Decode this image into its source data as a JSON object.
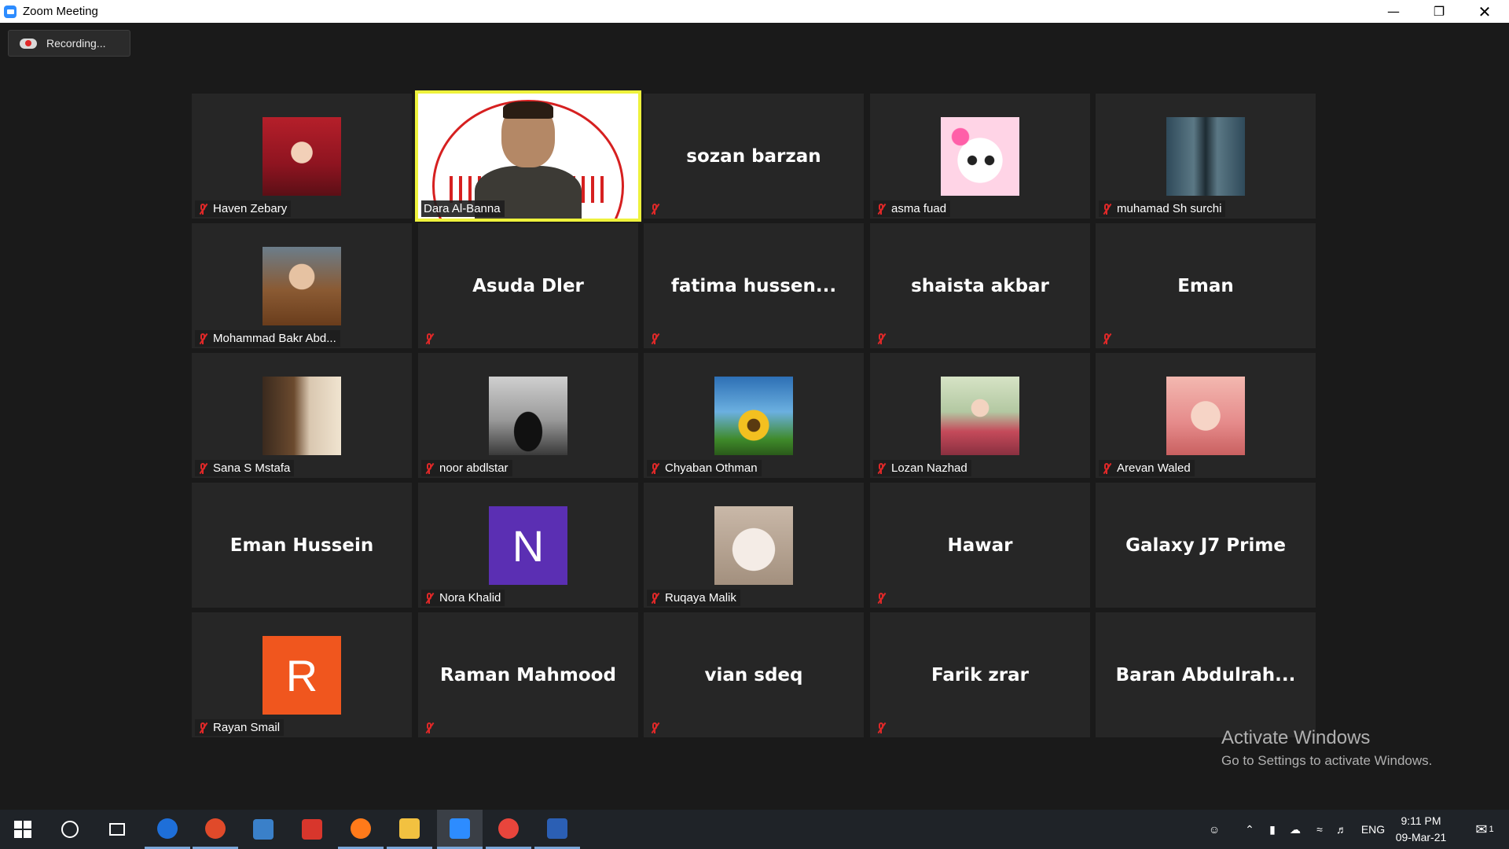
{
  "window": {
    "title": "Zoom Meeting"
  },
  "recording": {
    "label": "Recording..."
  },
  "participants": [
    {
      "name": "Haven Zebary",
      "avatar": "av-red-scarf",
      "muted": true
    },
    {
      "name": "Dara Al-Banna",
      "presenter": true,
      "muted": false
    },
    {
      "name": "sozan barzan",
      "muted": true
    },
    {
      "name": "asma fuad",
      "avatar": "av-cat-pink",
      "muted": true
    },
    {
      "name": "muhamad Sh surchi",
      "avatar": "av-man-street",
      "muted": true
    },
    {
      "name": "Mohammad Bakr Abd...",
      "avatar": "av-man-brown",
      "muted": true
    },
    {
      "name": "Asuda Dler",
      "muted": true
    },
    {
      "name": "fatima  hussen...",
      "muted": true
    },
    {
      "name": "shaista akbar",
      "muted": true
    },
    {
      "name": "Eman",
      "muted": true
    },
    {
      "name": "Sana S Mstafa",
      "avatar": "av-horse",
      "muted": true
    },
    {
      "name": "noor abdlstar",
      "avatar": "av-girl-bw",
      "muted": true
    },
    {
      "name": "Chyaban Othman",
      "avatar": "av-sunflower",
      "muted": true
    },
    {
      "name": "Lozan Nazhad",
      "avatar": "av-anime-girl",
      "muted": true
    },
    {
      "name": "Arevan Waled",
      "avatar": "av-baby",
      "muted": true
    },
    {
      "name": "Eman Hussein",
      "muted": false
    },
    {
      "name": "Nora Khalid",
      "letter": "N",
      "letter_color": "#5b2fb3",
      "muted": true
    },
    {
      "name": "Ruqaya Malik",
      "avatar": "av-white-cat",
      "muted": true
    },
    {
      "name": "Hawar",
      "muted": true
    },
    {
      "name": "Galaxy J7 Prime",
      "muted": false
    },
    {
      "name": "Rayan Smail",
      "letter": "R",
      "letter_color": "#f0561e",
      "muted": true
    },
    {
      "name": "Raman Mahmood",
      "muted": true
    },
    {
      "name": "vian sdeq",
      "muted": true
    },
    {
      "name": "Farik zrar",
      "muted": true
    },
    {
      "name": "Baran  Abdulrah...",
      "muted": false
    }
  ],
  "watermark": {
    "line1": "Activate Windows",
    "line2": "Go to Settings to activate Windows."
  },
  "taskbar": {
    "apps": [
      {
        "name": "start-button",
        "icon": "windows-icon"
      },
      {
        "name": "search-button",
        "icon": "search-circle-icon"
      },
      {
        "name": "task-view-button",
        "icon": "task-view-icon"
      },
      {
        "name": "teamviewer-app",
        "icon": "teamviewer-icon",
        "color": "#1e6fd9"
      },
      {
        "name": "browser-app-1",
        "icon": "browser-icon",
        "color": "#e04a2a"
      },
      {
        "name": "task-manager-app",
        "icon": "chart-icon",
        "color": "#3a80c9"
      },
      {
        "name": "media-app",
        "icon": "media-icon",
        "color": "#d8362c"
      },
      {
        "name": "firefox-app",
        "icon": "firefox-icon",
        "color": "#ff7a1a"
      },
      {
        "name": "file-explorer-app",
        "icon": "folder-icon",
        "color": "#f2c140"
      },
      {
        "name": "zoom-app",
        "icon": "zoom-icon",
        "color": "#2d8cff"
      },
      {
        "name": "chrome-app",
        "icon": "chrome-icon",
        "color": "#e8453c"
      },
      {
        "name": "word-app",
        "icon": "word-icon",
        "color": "#2b5fb4"
      }
    ],
    "lang": "ENG",
    "time": "9:11 PM",
    "date": "09-Mar-21",
    "notifications": "1"
  }
}
